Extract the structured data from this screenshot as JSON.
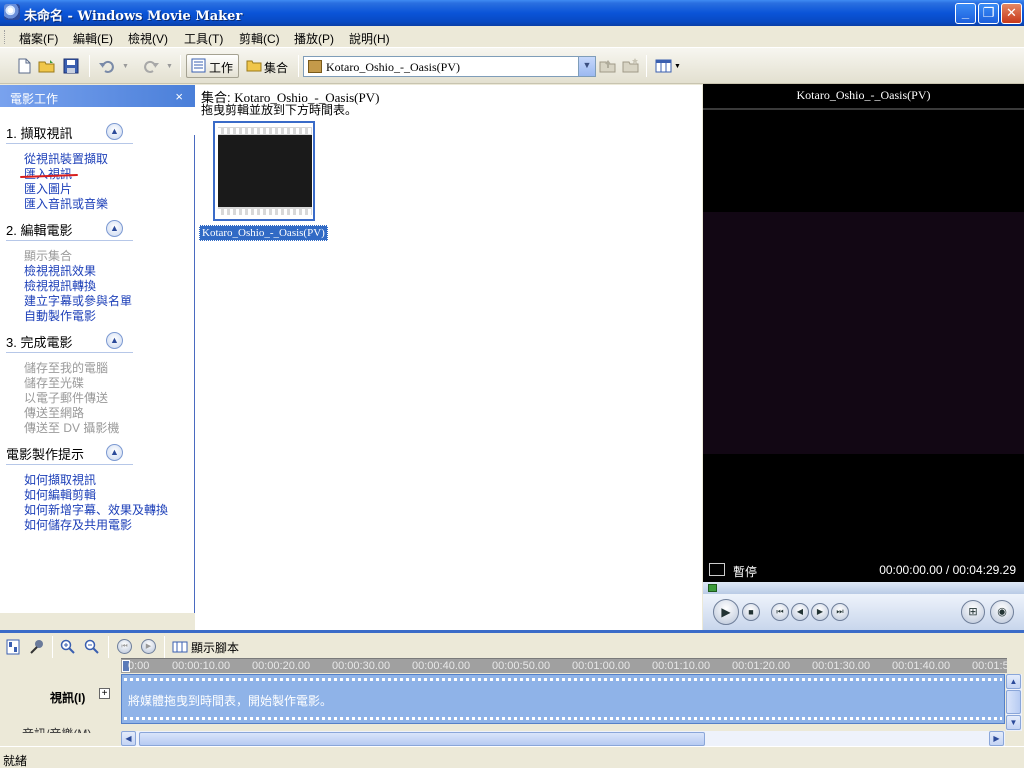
{
  "window": {
    "title": "未命名 - Windows Movie Maker"
  },
  "menu": [
    "檔案(F)",
    "編輯(E)",
    "檢視(V)",
    "工具(T)",
    "剪輯(C)",
    "播放(P)",
    "說明(H)"
  ],
  "toolbar": {
    "tasks_label": "工作",
    "collections_label": "集合",
    "collection_select": "Kotaro_Oshio_-_Oasis(PV)"
  },
  "taskpane": {
    "header": "電影工作",
    "close": "×",
    "sections": [
      {
        "title": "1. 擷取視訊",
        "links": [
          "從視訊裝置擷取",
          "匯入視訊",
          "匯入圖片",
          "匯入音訊或音樂"
        ]
      },
      {
        "title": "2. 編輯電影",
        "links": [
          "顯示集合",
          "檢視視訊效果",
          "檢視視訊轉換",
          "建立字幕或參與名單",
          "自動製作電影"
        ]
      },
      {
        "title": "3. 完成電影",
        "links": [
          "儲存至我的電腦",
          "儲存至光碟",
          "以電子郵件傳送",
          "傳送至網路",
          "傳送至 DV 攝影機"
        ]
      },
      {
        "title": "電影製作提示",
        "links": [
          "如何擷取視訊",
          "如何編輯剪輯",
          "如何新增字幕、效果及轉換",
          "如何儲存及共用電影"
        ]
      }
    ]
  },
  "collection": {
    "title_prefix": "集合:",
    "title_name": "Kotaro_Oshio_-_Oasis(PV)",
    "hint": "拖曳剪輯並放到下方時間表。",
    "clip_label": "Kotaro_Oshio_-_Oasis(PV)"
  },
  "monitor": {
    "title": "Kotaro_Oshio_-_Oasis(PV)",
    "state": "暫停",
    "time": "00:00:00.00 / 00:04:29.29",
    "seek_fraction": 0.0
  },
  "timeline": {
    "show_storyboard": "顯示腳本",
    "ruler": [
      "0:00",
      "00:00:10.00",
      "00:00:20.00",
      "00:00:30.00",
      "00:00:40.00",
      "00:00:50.00",
      "00:01:00.00",
      "00:01:10.00",
      "00:01:20.00",
      "00:01:30.00",
      "00:01:40.00",
      "00:01:5"
    ],
    "video_track": "視訊(I)",
    "audio_track": "音訊/音樂(M)",
    "drop_hint": "將媒體拖曳到時間表，開始製作電影。"
  },
  "status": "就緒"
}
